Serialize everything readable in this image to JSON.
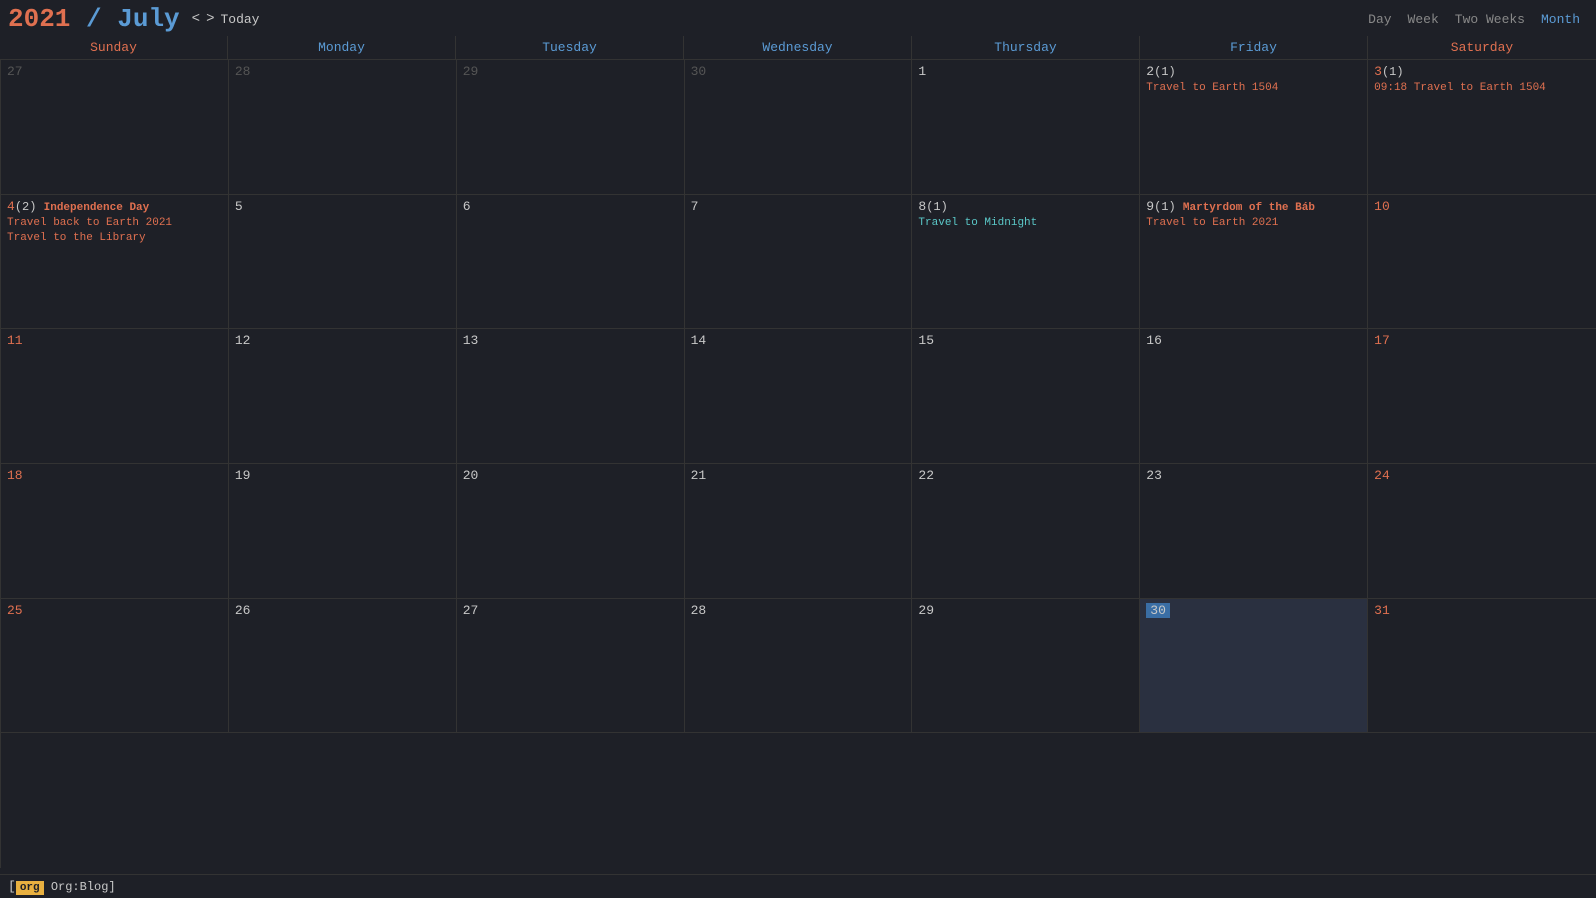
{
  "header": {
    "year": "2021",
    "separator": " / ",
    "month": "July",
    "nav": {
      "prev": "<",
      "next": ">",
      "today": "Today"
    },
    "views": [
      "Day",
      "Week",
      "Two Weeks",
      "Month"
    ],
    "active_view": "Month"
  },
  "day_headers": [
    {
      "label": "Sunday",
      "type": "weekend"
    },
    {
      "label": "Monday",
      "type": "weekday"
    },
    {
      "label": "Tuesday",
      "type": "weekday"
    },
    {
      "label": "Wednesday",
      "type": "weekday"
    },
    {
      "label": "Thursday",
      "type": "weekday"
    },
    {
      "label": "Friday",
      "type": "weekday"
    },
    {
      "label": "Saturday",
      "type": "weekend"
    }
  ],
  "weeks": [
    {
      "days": [
        {
          "num": "27",
          "type": "other sunday",
          "events": []
        },
        {
          "num": "28",
          "type": "other weekday",
          "events": []
        },
        {
          "num": "29",
          "type": "other weekday",
          "events": []
        },
        {
          "num": "30",
          "type": "other weekday",
          "events": []
        },
        {
          "num": "1",
          "type": "weekday",
          "events": []
        },
        {
          "num": "2",
          "type": "weekday",
          "count": "(1)",
          "events": [
            {
              "text": "Travel to Earth 1504",
              "color": "orange"
            }
          ]
        },
        {
          "num": "3",
          "type": "saturday",
          "count": "(1)",
          "events": [
            {
              "text": "09:18 Travel to Earth 1504",
              "color": "orange"
            }
          ]
        }
      ]
    },
    {
      "days": [
        {
          "num": "4",
          "type": "sunday",
          "count": "(2)",
          "label": "Independence Day",
          "events": [
            {
              "text": "Travel back to Earth 2021",
              "color": "orange"
            },
            {
              "text": "Travel to the Library",
              "color": "orange"
            }
          ]
        },
        {
          "num": "5",
          "type": "weekday",
          "events": []
        },
        {
          "num": "6",
          "type": "weekday",
          "events": []
        },
        {
          "num": "7",
          "type": "weekday",
          "events": []
        },
        {
          "num": "8",
          "type": "weekday",
          "count": "(1)",
          "events": [
            {
              "text": "Travel to Midnight",
              "color": "cyan"
            }
          ]
        },
        {
          "num": "9",
          "type": "weekday",
          "count": "(1)",
          "label": "Martyrdom of the Báb",
          "events": [
            {
              "text": "Travel to Earth 2021",
              "color": "orange"
            }
          ]
        },
        {
          "num": "10",
          "type": "saturday",
          "events": []
        }
      ]
    },
    {
      "days": [
        {
          "num": "11",
          "type": "sunday",
          "events": []
        },
        {
          "num": "12",
          "type": "weekday",
          "events": []
        },
        {
          "num": "13",
          "type": "weekday",
          "events": []
        },
        {
          "num": "14",
          "type": "weekday",
          "events": []
        },
        {
          "num": "15",
          "type": "weekday",
          "events": []
        },
        {
          "num": "16",
          "type": "weekday",
          "events": []
        },
        {
          "num": "17",
          "type": "saturday",
          "events": []
        }
      ]
    },
    {
      "days": [
        {
          "num": "18",
          "type": "sunday",
          "events": []
        },
        {
          "num": "19",
          "type": "weekday",
          "events": []
        },
        {
          "num": "20",
          "type": "weekday",
          "events": []
        },
        {
          "num": "21",
          "type": "weekday",
          "events": []
        },
        {
          "num": "22",
          "type": "weekday",
          "events": []
        },
        {
          "num": "23",
          "type": "weekday",
          "events": []
        },
        {
          "num": "24",
          "type": "saturday",
          "events": []
        }
      ]
    },
    {
      "days": [
        {
          "num": "25",
          "type": "sunday",
          "events": []
        },
        {
          "num": "26",
          "type": "weekday",
          "events": []
        },
        {
          "num": "27",
          "type": "weekday",
          "events": []
        },
        {
          "num": "28",
          "type": "weekday",
          "events": []
        },
        {
          "num": "29",
          "type": "weekday",
          "events": []
        },
        {
          "num": "30",
          "type": "weekday today",
          "events": []
        },
        {
          "num": "31",
          "type": "saturday",
          "events": []
        }
      ]
    }
  ],
  "footer": {
    "tag": "org",
    "label": "Org:Blog]"
  }
}
